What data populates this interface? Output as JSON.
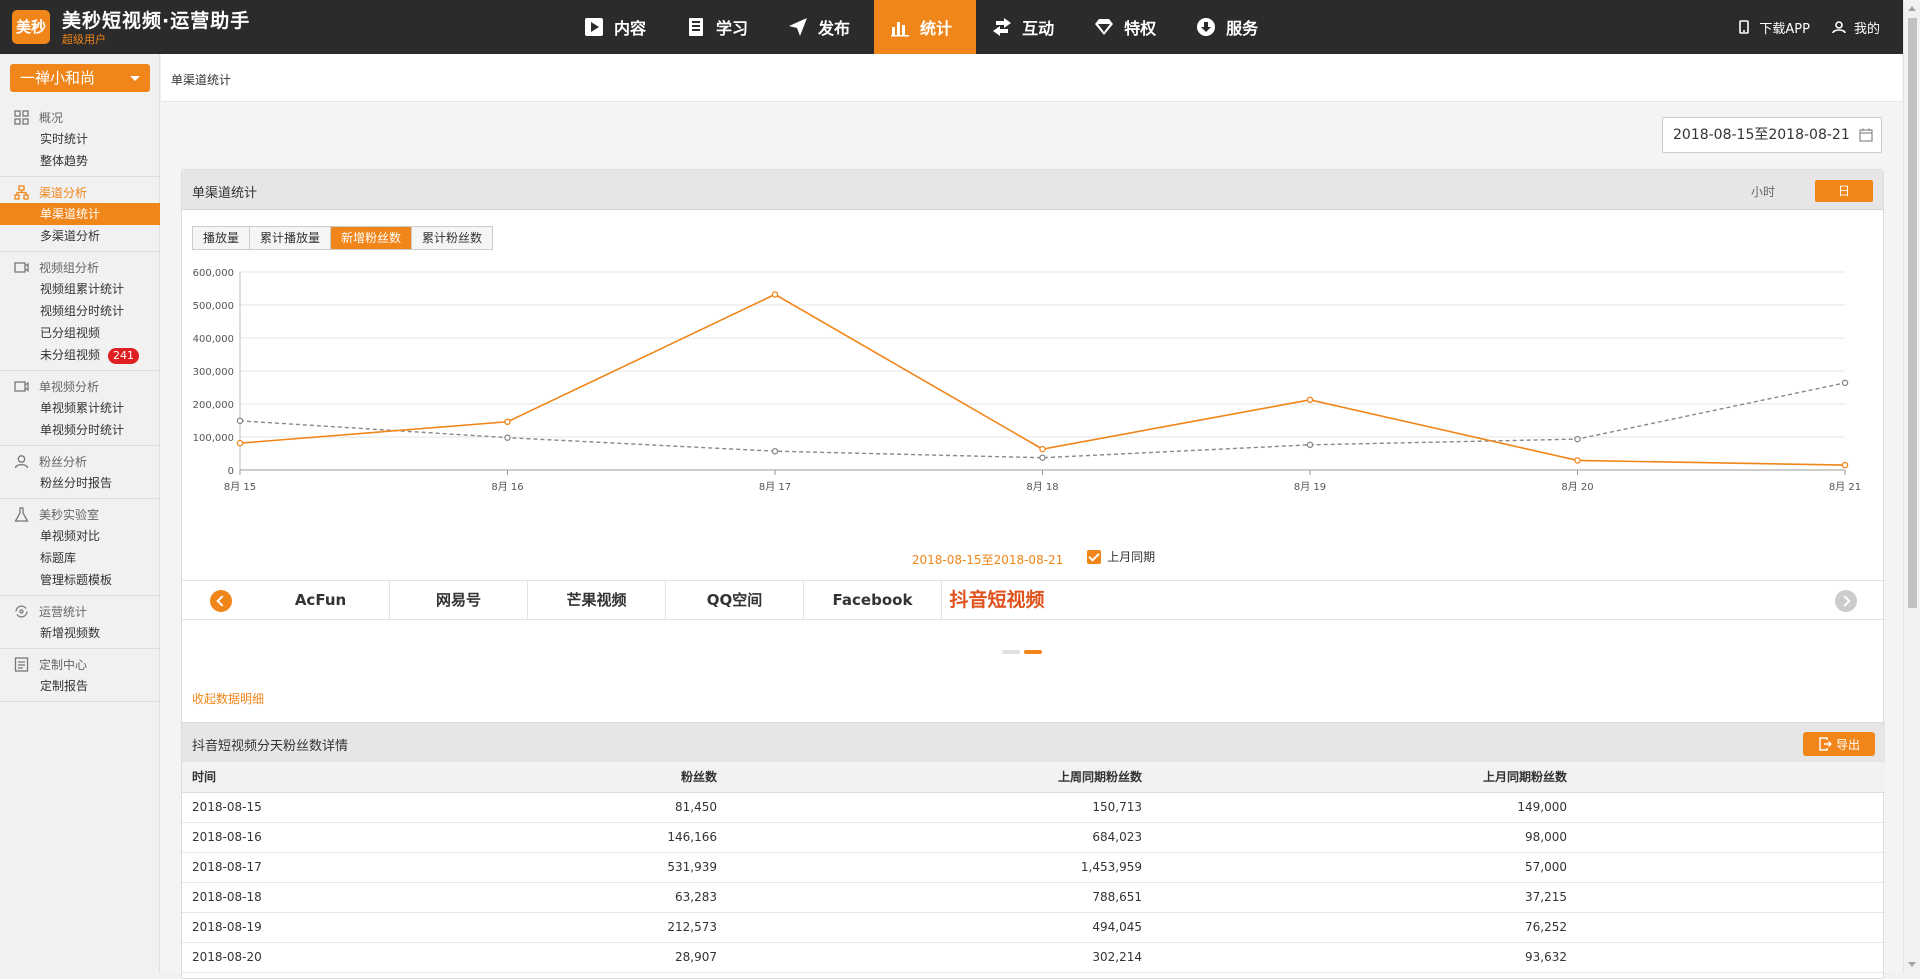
{
  "app": {
    "logo_text": "美秒",
    "title": "美秒短视频·运营助手",
    "subtitle": "超级用户"
  },
  "nav": [
    {
      "label": "内容",
      "icon": "play-icon",
      "active": false
    },
    {
      "label": "学习",
      "icon": "book-icon",
      "active": false
    },
    {
      "label": "发布",
      "icon": "send-icon",
      "active": false
    },
    {
      "label": "统计",
      "icon": "bar-chart-icon",
      "active": true
    },
    {
      "label": "互动",
      "icon": "exchange-icon",
      "active": false
    },
    {
      "label": "特权",
      "icon": "diamond-icon",
      "active": false
    },
    {
      "label": "服务",
      "icon": "cloud-download-icon",
      "active": false
    }
  ],
  "top_right": {
    "download": "下载APP",
    "mine": "我的"
  },
  "sidebar": {
    "account": "一禅小和尚",
    "groups": [
      {
        "title": "概况",
        "icon": "grid-icon",
        "active": false,
        "items": [
          {
            "label": "实时统计"
          },
          {
            "label": "整体趋势"
          }
        ]
      },
      {
        "title": "渠道分析",
        "icon": "org-chart-icon",
        "active": true,
        "items": [
          {
            "label": "单渠道统计",
            "active": true
          },
          {
            "label": "多渠道分析"
          }
        ]
      },
      {
        "title": "视频组分析",
        "icon": "video-group-icon",
        "active": false,
        "items": [
          {
            "label": "视频组累计统计"
          },
          {
            "label": "视频组分时统计"
          },
          {
            "label": "已分组视频"
          },
          {
            "label": "未分组视频",
            "badge": "241"
          }
        ]
      },
      {
        "title": "单视频分析",
        "icon": "video-icon",
        "active": false,
        "items": [
          {
            "label": "单视频累计统计"
          },
          {
            "label": "单视频分时统计"
          }
        ]
      },
      {
        "title": "粉丝分析",
        "icon": "user-icon",
        "active": false,
        "items": [
          {
            "label": "粉丝分时报告"
          }
        ]
      },
      {
        "title": "美秒实验室",
        "icon": "flask-icon",
        "active": false,
        "items": [
          {
            "label": "单视频对比"
          },
          {
            "label": "标题库"
          },
          {
            "label": "管理标题模板"
          }
        ]
      },
      {
        "title": "运营统计",
        "icon": "cycle-icon",
        "active": false,
        "items": [
          {
            "label": "新增视频数"
          }
        ]
      },
      {
        "title": "定制中心",
        "icon": "document-icon",
        "active": false,
        "items": [
          {
            "label": "定制报告"
          }
        ]
      }
    ]
  },
  "breadcrumb": "单渠道统计",
  "date_range": "2018-08-15至2018-08-21",
  "panel": {
    "title": "单渠道统计",
    "granularity": {
      "hour": "小时",
      "day": "日"
    },
    "metric_tabs": [
      {
        "label": "播放量"
      },
      {
        "label": "累计播放量"
      },
      {
        "label": "新增粉丝数",
        "active": true
      },
      {
        "label": "累计粉丝数"
      }
    ],
    "legend": {
      "current": "2018-08-15至2018-08-21",
      "compare": "上月同期"
    },
    "platform_tabs": [
      {
        "label": "AcFun"
      },
      {
        "label": "网易号"
      },
      {
        "label": "芒果视频"
      },
      {
        "label": "QQ空间"
      },
      {
        "label": "Facebook"
      },
      {
        "label": "抖音短视频",
        "active": true
      }
    ],
    "collapse_label": "收起数据明细"
  },
  "chart_data": {
    "type": "line",
    "categories": [
      "8月 15",
      "8月 16",
      "8月 17",
      "8月 18",
      "8月 19",
      "8月 20",
      "8月 21"
    ],
    "y_ticks": [
      "0",
      "100,000",
      "200,000",
      "300,000",
      "400,000",
      "500,000",
      "600,000"
    ],
    "ylim": [
      0,
      600000
    ],
    "series": [
      {
        "name": "2018-08-15至2018-08-21",
        "color": "#f08519",
        "style": "solid",
        "values": [
          81450,
          146166,
          531939,
          63283,
          212573,
          28907,
          15000
        ]
      },
      {
        "name": "上月同期",
        "color": "#888888",
        "style": "dashed",
        "values": [
          149000,
          98000,
          57000,
          37215,
          76252,
          93632,
          264000
        ]
      }
    ],
    "grid": true,
    "legend_position": "bottom"
  },
  "detail": {
    "title": "抖音短视频分天粉丝数详情",
    "export_label": "导出",
    "columns": [
      "时间",
      "粉丝数",
      "上周同期粉丝数",
      "上月同期粉丝数"
    ],
    "rows": [
      [
        "2018-08-15",
        "81,450",
        "150,713",
        "149,000"
      ],
      [
        "2018-08-16",
        "146,166",
        "684,023",
        "98,000"
      ],
      [
        "2018-08-17",
        "531,939",
        "1,453,959",
        "57,000"
      ],
      [
        "2018-08-18",
        "63,283",
        "788,651",
        "37,215"
      ],
      [
        "2018-08-19",
        "212,573",
        "494,045",
        "76,252"
      ],
      [
        "2018-08-20",
        "28,907",
        "302,214",
        "93,632"
      ]
    ]
  },
  "colors": {
    "accent": "#f08519",
    "topbar": "#2b2b2b",
    "compare_line": "#888888"
  }
}
